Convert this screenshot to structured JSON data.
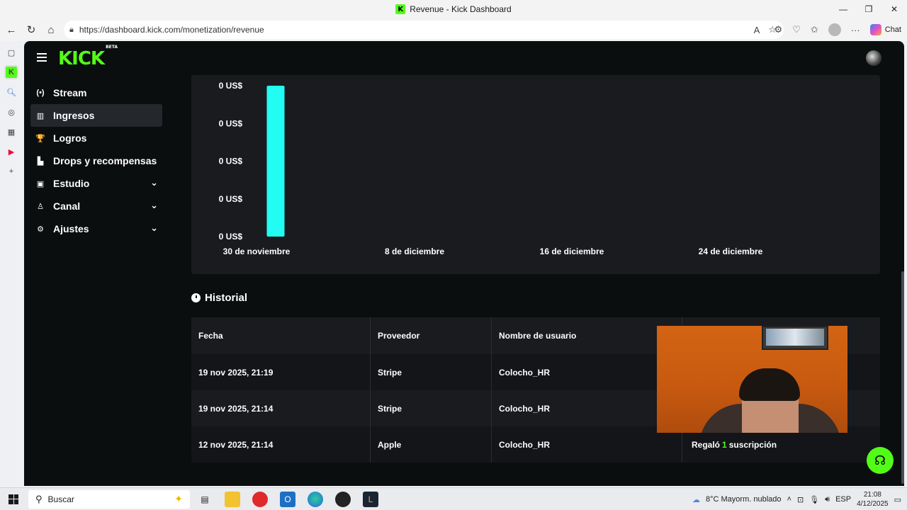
{
  "window": {
    "title": "Revenue - Kick Dashboard",
    "minimize": "—",
    "restore": "❐",
    "close": "✕"
  },
  "browser": {
    "url": "https://dashboard.kick.com/monetization/revenue",
    "chat_label": "Chat"
  },
  "app": {
    "logo_text": "KICK",
    "logo_badge": "BETA"
  },
  "sidebar": {
    "items": [
      {
        "label": "Stream",
        "icon": "(•)",
        "active": false,
        "expandable": false
      },
      {
        "label": "Ingresos",
        "icon": "▥",
        "active": true,
        "expandable": false
      },
      {
        "label": "Logros",
        "icon": "🏆",
        "active": false,
        "expandable": false
      },
      {
        "label": "Drops y recompensas",
        "icon": "▙",
        "active": false,
        "expandable": false
      },
      {
        "label": "Estudio",
        "icon": "▣",
        "active": false,
        "expandable": true
      },
      {
        "label": "Canal",
        "icon": "♙",
        "active": false,
        "expandable": true
      },
      {
        "label": "Ajustes",
        "icon": "⚙",
        "active": false,
        "expandable": true
      }
    ],
    "chevron": "⌄"
  },
  "chart_data": {
    "type": "bar",
    "y_tick_labels": [
      "0 US$",
      "0 US$",
      "0 US$",
      "0 US$",
      "0 US$"
    ],
    "x_tick_labels": [
      "30 de noviembre",
      "8 de diciembre",
      "16 de diciembre",
      "24 de diciembre"
    ],
    "bar_color": "#22fcf2",
    "bars": [
      {
        "position": "30 de noviembre",
        "value": 1.0
      }
    ],
    "ylim": [
      0,
      1
    ]
  },
  "history": {
    "title": "Historial",
    "columns": [
      "Fecha",
      "Proveedor",
      "Nombre de usuario",
      ""
    ],
    "rows": [
      {
        "fecha": "19 nov 2025, 21:19",
        "proveedor": "Stripe",
        "usuario": "Colocho_HR",
        "detalle_pre": "",
        "detalle_num": "",
        "detalle_post": ""
      },
      {
        "fecha": "19 nov 2025, 21:14",
        "proveedor": "Stripe",
        "usuario": "Colocho_HR",
        "detalle_pre": "",
        "detalle_num": "",
        "detalle_post": ""
      },
      {
        "fecha": "12 nov 2025, 21:14",
        "proveedor": "Apple",
        "usuario": "Colocho_HR",
        "detalle_pre": "Regaló",
        "detalle_num": "1",
        "detalle_post": "suscripción"
      }
    ]
  },
  "taskbar": {
    "search_placeholder": "Buscar",
    "weather": "8°C  Mayorm. nublado",
    "lang": "ESP",
    "time": "21:08",
    "date": "4/12/2025"
  },
  "colors": {
    "accent": "#53fc18",
    "app_bg": "#0b0e0f",
    "card_bg": "#191b1f"
  }
}
